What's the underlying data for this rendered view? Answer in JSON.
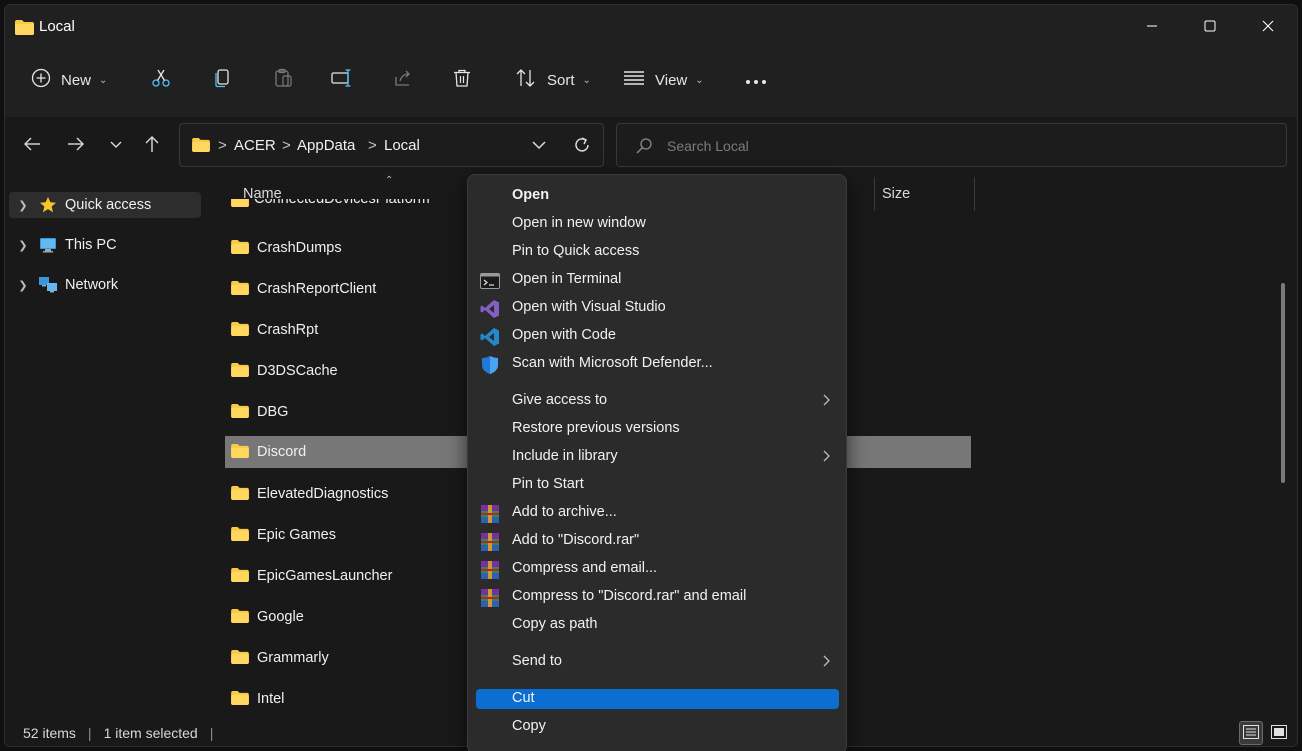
{
  "window": {
    "title": "Local",
    "minimize_icon": "minimize-icon",
    "maximize_icon": "maximize-icon",
    "close_icon": "close-icon"
  },
  "toolbar": {
    "new_label": "New",
    "sort_label": "Sort",
    "view_label": "View",
    "icons": [
      "plus-circle-icon",
      "cut-icon",
      "copy-icon",
      "paste-icon",
      "rename-icon",
      "share-icon",
      "delete-icon",
      "sort-icon",
      "view-icon",
      "more-icon"
    ]
  },
  "address": {
    "crumbs": [
      "ACER",
      "AppData",
      "Local"
    ],
    "separator": ">",
    "search_placeholder": "Search Local"
  },
  "nav": {
    "items": [
      {
        "label": "Quick access",
        "icon": "star-icon",
        "selected": true
      },
      {
        "label": "This PC",
        "icon": "computer-icon",
        "selected": false
      },
      {
        "label": "Network",
        "icon": "network-icon",
        "selected": false
      }
    ]
  },
  "filelist": {
    "columns": {
      "name": "Name",
      "size": "Size"
    },
    "partial_item": "ConnectedDevicesPlatform",
    "items": [
      "CrashDumps",
      "CrashReportClient",
      "CrashRpt",
      "D3DSCache",
      "DBG",
      "Discord",
      "ElevatedDiagnostics",
      "Epic Games",
      "EpicGamesLauncher",
      "Google",
      "Grammarly",
      "Intel"
    ],
    "selected": "Discord"
  },
  "status": {
    "items": "52 items",
    "selection": "1 item selected"
  },
  "context_menu": {
    "items": [
      {
        "label": "Open",
        "bold": true,
        "icon": ""
      },
      {
        "label": "Open in new window",
        "icon": ""
      },
      {
        "label": "Pin to Quick access",
        "icon": ""
      },
      {
        "label": "Open in Terminal",
        "icon": "terminal-icon"
      },
      {
        "label": "Open with Visual Studio",
        "icon": "visual-studio-icon"
      },
      {
        "label": "Open with Code",
        "icon": "vscode-icon"
      },
      {
        "label": "Scan with Microsoft Defender...",
        "icon": "defender-shield-icon"
      },
      {
        "label": "Give access to",
        "icon": "",
        "submenu": true
      },
      {
        "label": "Restore previous versions",
        "icon": ""
      },
      {
        "label": "Include in library",
        "icon": "",
        "submenu": true
      },
      {
        "label": "Pin to Start",
        "icon": ""
      },
      {
        "label": "Add to archive...",
        "icon": "winrar-icon"
      },
      {
        "label": "Add to \"Discord.rar\"",
        "icon": "winrar-icon"
      },
      {
        "label": "Compress and email...",
        "icon": "winrar-icon"
      },
      {
        "label": "Compress to \"Discord.rar\" and email",
        "icon": "winrar-icon"
      },
      {
        "label": "Copy as path",
        "icon": ""
      },
      {
        "label": "Send to",
        "icon": "",
        "submenu": true
      },
      {
        "label": "Cut",
        "icon": "",
        "highlighted": true
      },
      {
        "label": "Copy",
        "icon": ""
      }
    ],
    "submenu_arrow": ">"
  },
  "colors": {
    "accent": "#0b6ed0",
    "folder": "#f7c948",
    "selection": "#777777"
  }
}
